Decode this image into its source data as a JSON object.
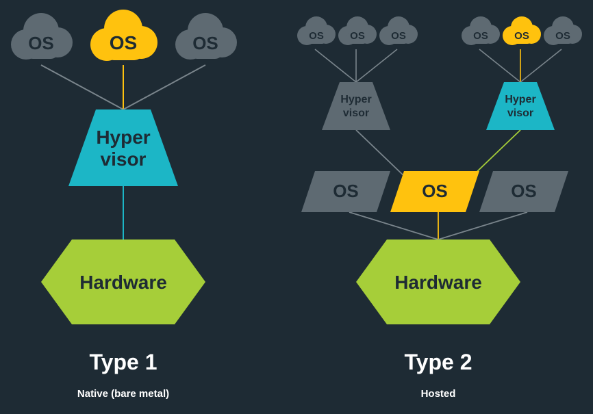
{
  "colors": {
    "bg": "#1e2b34",
    "gray": "#5e6a72",
    "gray_line": "#7a858c",
    "yellow": "#ffc20e",
    "teal": "#1cb6c6",
    "lime": "#a6ce39",
    "white": "#ffffff",
    "dark": "#1e2b34"
  },
  "labels": {
    "os": "OS",
    "hypervisor_line1": "Hyper",
    "hypervisor_line2": "visor",
    "hardware": "Hardware"
  },
  "type1": {
    "title": "Type 1",
    "subtitle": "Native (bare metal)"
  },
  "type2": {
    "title": "Type 2",
    "subtitle": "Hosted"
  }
}
